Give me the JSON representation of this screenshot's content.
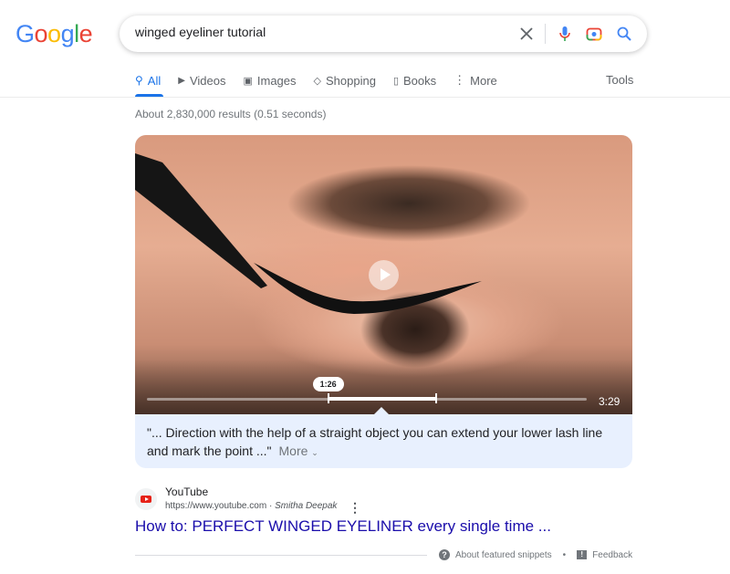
{
  "logo": {
    "text": "Google",
    "letters": [
      "G",
      "o",
      "o",
      "g",
      "l",
      "e"
    ],
    "colors": [
      "#4285f4",
      "#ea4335",
      "#fbbc05",
      "#4285f4",
      "#34a853",
      "#ea4335"
    ]
  },
  "search": {
    "query": "winged eyeliner tutorial",
    "icons": [
      "close-icon",
      "microphone-icon",
      "camera-lens-icon",
      "search-icon"
    ]
  },
  "tabs": [
    {
      "label": "All",
      "icon": "search-icon",
      "active": true
    },
    {
      "label": "Videos",
      "icon": "video-icon"
    },
    {
      "label": "Images",
      "icon": "image-icon"
    },
    {
      "label": "Shopping",
      "icon": "tag-icon"
    },
    {
      "label": "Books",
      "icon": "book-icon"
    },
    {
      "label": "More",
      "icon": "kebab-icon"
    }
  ],
  "tools_label": "Tools",
  "stats": "About 2,830,000 results (0.51 seconds)",
  "video": {
    "current_time": "1:26",
    "duration": "3:29",
    "clip_start_fraction": 0.412,
    "clip_end_fraction": 0.658
  },
  "snippet": {
    "text": "\"... Direction with the help of a straight object you can extend your lower lash line and mark the point ...\"",
    "more": "More"
  },
  "result": {
    "site": "YouTube",
    "url": "https://www.youtube.com",
    "separator": " · ",
    "author": "Smitha Deepak",
    "title": "How to: PERFECT WINGED EYELINER every single time ..."
  },
  "footer": {
    "about": "About featured snippets",
    "dot": "•",
    "feedback": "Feedback"
  },
  "colors": {
    "accent": "#1a73e8",
    "link": "#1a0dab",
    "snippet_bg": "#e8f0fe"
  }
}
